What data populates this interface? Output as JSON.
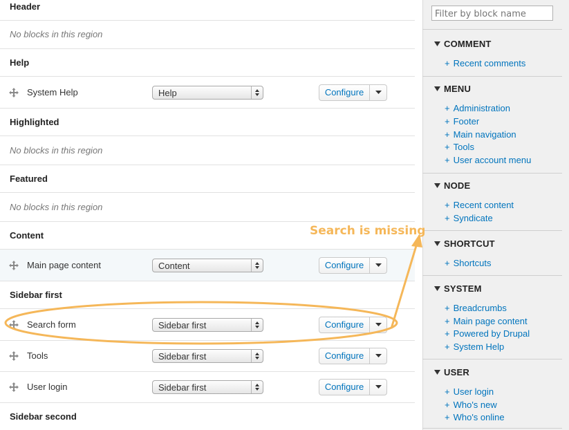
{
  "regions": {
    "header": {
      "title": "Header",
      "empty_text": "No blocks in this region"
    },
    "help": {
      "title": "Help"
    },
    "highlighted": {
      "title": "Highlighted",
      "empty_text": "No blocks in this region"
    },
    "featured": {
      "title": "Featured",
      "empty_text": "No blocks in this region"
    },
    "content": {
      "title": "Content"
    },
    "sidebar_first": {
      "title": "Sidebar first"
    },
    "sidebar_second": {
      "title": "Sidebar second"
    }
  },
  "blocks": [
    {
      "name": "System Help",
      "region": "Help",
      "action": "Configure"
    },
    {
      "name": "Main page content",
      "region": "Content",
      "action": "Configure"
    },
    {
      "name": "Search form",
      "region": "Sidebar first",
      "action": "Configure"
    },
    {
      "name": "Tools",
      "region": "Sidebar first",
      "action": "Configure"
    },
    {
      "name": "User login",
      "region": "Sidebar first",
      "action": "Configure"
    }
  ],
  "sidebar": {
    "filter_placeholder": "Filter by block name",
    "categories": [
      {
        "title": "COMMENT",
        "links": [
          "Recent comments"
        ]
      },
      {
        "title": "MENU",
        "links": [
          "Administration",
          "Footer",
          "Main navigation",
          "Tools",
          "User account menu"
        ]
      },
      {
        "title": "NODE",
        "links": [
          "Recent content",
          "Syndicate"
        ]
      },
      {
        "title": "SHORTCUT",
        "links": [
          "Shortcuts"
        ]
      },
      {
        "title": "SYSTEM",
        "links": [
          "Breadcrumbs",
          "Main page content",
          "Powered by Drupal",
          "System Help"
        ]
      },
      {
        "title": "USER",
        "links": [
          "User login",
          "Who's new",
          "Who's online"
        ]
      }
    ],
    "plus": "+"
  },
  "annotation": {
    "text": "Search is missing",
    "color": "#f5b759"
  },
  "colors": {
    "link": "#0074bd",
    "sidebar_bg": "#f0f0f0"
  }
}
